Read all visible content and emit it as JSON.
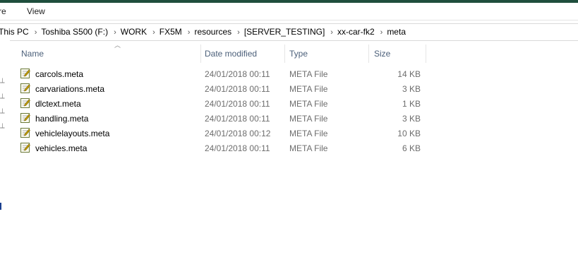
{
  "ribbon": {
    "tabs": [
      "re",
      "View"
    ]
  },
  "address": {
    "crumbs": [
      "This PC",
      "Toshiba S500 (F:)",
      "WORK",
      "FX5M",
      "resources",
      "[SERVER_TESTING]",
      "xx-car-fk2",
      "meta"
    ]
  },
  "columns": {
    "name": "Name",
    "date": "Date modified",
    "type": "Type",
    "size": "Size"
  },
  "files": [
    {
      "name": "carcols.meta",
      "date": "24/01/2018 00:11",
      "type": "META File",
      "size": "14 KB"
    },
    {
      "name": "carvariations.meta",
      "date": "24/01/2018 00:11",
      "type": "META File",
      "size": "3 KB"
    },
    {
      "name": "dlctext.meta",
      "date": "24/01/2018 00:11",
      "type": "META File",
      "size": "1 KB"
    },
    {
      "name": "handling.meta",
      "date": "24/01/2018 00:11",
      "type": "META File",
      "size": "3 KB"
    },
    {
      "name": "vehiclelayouts.meta",
      "date": "24/01/2018 00:12",
      "type": "META File",
      "size": "10 KB"
    },
    {
      "name": "vehicles.meta",
      "date": "24/01/2018 00:11",
      "type": "META File",
      "size": "6 KB"
    }
  ],
  "icons": {
    "file": "meta-file-icon",
    "pin": "pin-icon",
    "sort": "sort-up-icon"
  }
}
